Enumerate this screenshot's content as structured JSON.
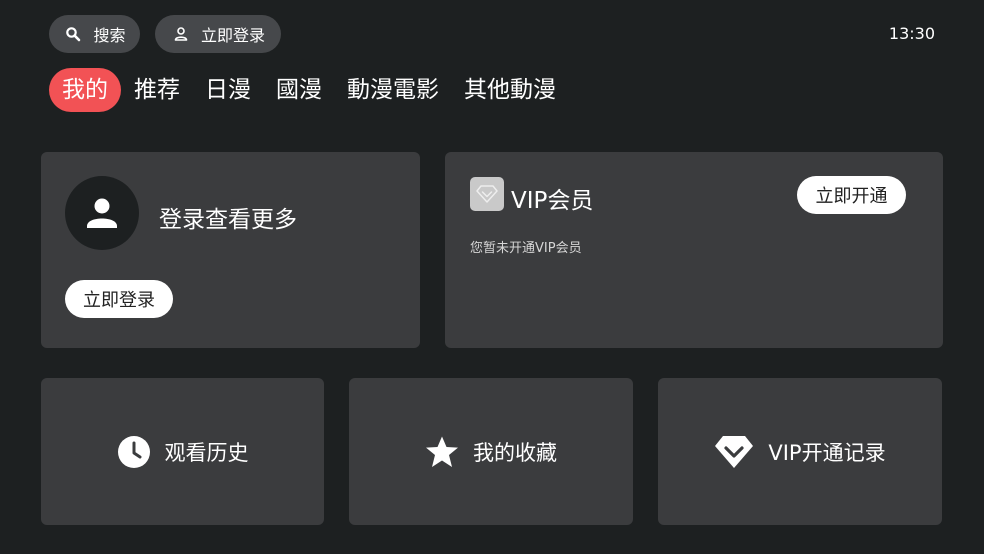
{
  "top_bar": {
    "search_label": "搜索",
    "login_label": "立即登录",
    "time": "13:30"
  },
  "tabs": [
    {
      "label": "我的",
      "active": true
    },
    {
      "label": "推荐"
    },
    {
      "label": "日漫"
    },
    {
      "label": "國漫"
    },
    {
      "label": "動漫電影"
    },
    {
      "label": "其他動漫"
    }
  ],
  "login_card": {
    "prompt": "登录查看更多",
    "button_label": "立即登录"
  },
  "vip_card": {
    "title": "VIP会员",
    "subtitle": "您暂未开通VIP会员",
    "button_label": "立即开通"
  },
  "shortcuts": {
    "history_label": "观看历史",
    "favorites_label": "我的收藏",
    "vip_record_label": "VIP开通记录"
  },
  "colors": {
    "background": "#1d2021",
    "card": "#3b3c3e",
    "accent": "#f25255"
  },
  "icons": [
    "search-icon",
    "user-icon",
    "avatar-icon",
    "vip-diamond-icon",
    "clock-icon",
    "star-icon",
    "diamond-icon"
  ]
}
